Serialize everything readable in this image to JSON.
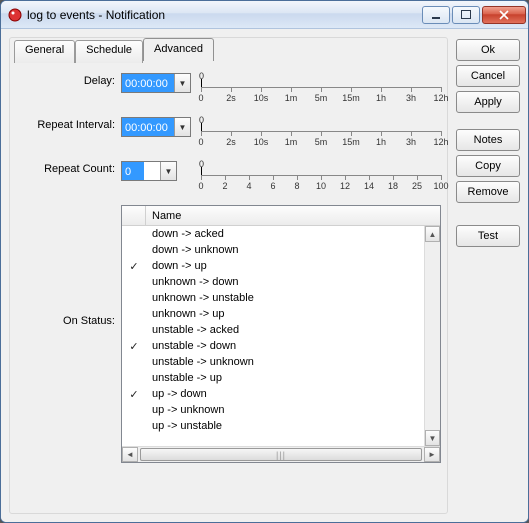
{
  "window": {
    "title": "log to events - Notification"
  },
  "tabs": {
    "general": "General",
    "schedule": "Schedule",
    "advanced": "Advanced"
  },
  "buttons": {
    "ok": "Ok",
    "cancel": "Cancel",
    "apply": "Apply",
    "notes": "Notes",
    "copy": "Copy",
    "remove": "Remove",
    "test": "Test"
  },
  "labels": {
    "delay": "Delay:",
    "repeat_interval": "Repeat Interval:",
    "repeat_count": "Repeat Count:",
    "on_status": "On Status:",
    "name_col": "Name"
  },
  "fields": {
    "delay": "00:00:00",
    "repeat_interval": "00:00:00",
    "repeat_count": "0"
  },
  "time_ticks": [
    "0",
    "2s",
    "10s",
    "1m",
    "5m",
    "15m",
    "1h",
    "3h",
    "12h"
  ],
  "count_ticks": [
    "0",
    "2",
    "4",
    "6",
    "8",
    "10",
    "12",
    "14",
    "18",
    "25",
    "100"
  ],
  "status_items": [
    {
      "checked": false,
      "name": "down -> acked"
    },
    {
      "checked": false,
      "name": "down -> unknown"
    },
    {
      "checked": true,
      "name": "down -> up"
    },
    {
      "checked": false,
      "name": "unknown -> down"
    },
    {
      "checked": false,
      "name": "unknown -> unstable"
    },
    {
      "checked": false,
      "name": "unknown -> up"
    },
    {
      "checked": false,
      "name": "unstable -> acked"
    },
    {
      "checked": true,
      "name": "unstable -> down"
    },
    {
      "checked": false,
      "name": "unstable -> unknown"
    },
    {
      "checked": false,
      "name": "unstable -> up"
    },
    {
      "checked": true,
      "name": "up -> down"
    },
    {
      "checked": false,
      "name": "up -> unknown"
    },
    {
      "checked": false,
      "name": "up -> unstable"
    }
  ]
}
